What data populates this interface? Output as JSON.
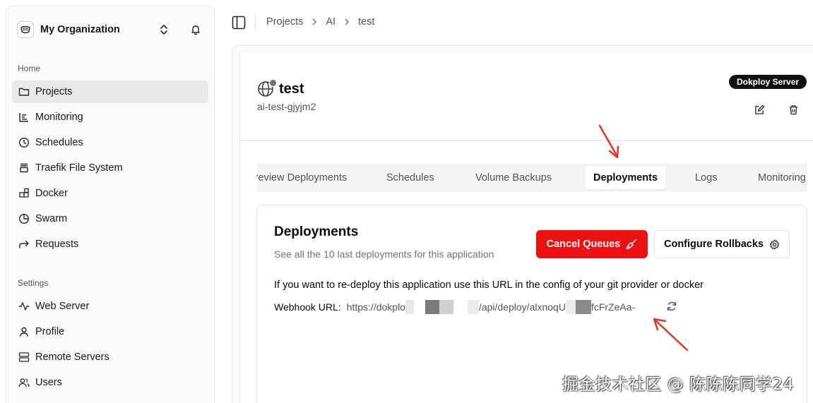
{
  "sidebar": {
    "org_name": "My Organization",
    "groups": [
      {
        "label": "Home"
      },
      {
        "label": "Settings"
      }
    ],
    "home_items": [
      {
        "label": "Projects",
        "icon": "folder-icon",
        "active": true
      },
      {
        "label": "Monitoring",
        "icon": "chart-icon"
      },
      {
        "label": "Schedules",
        "icon": "clock-icon"
      },
      {
        "label": "Traefik File System",
        "icon": "layers-icon"
      },
      {
        "label": "Docker",
        "icon": "blocks-icon"
      },
      {
        "label": "Swarm",
        "icon": "pie-icon"
      },
      {
        "label": "Requests",
        "icon": "forward-arrow-icon"
      }
    ],
    "settings_items": [
      {
        "label": "Web Server",
        "icon": "activity-icon"
      },
      {
        "label": "Profile",
        "icon": "user-icon"
      },
      {
        "label": "Remote Servers",
        "icon": "server-icon"
      },
      {
        "label": "Users",
        "icon": "users-icon"
      }
    ]
  },
  "breadcrumb": [
    "Projects",
    "AI",
    "test"
  ],
  "app": {
    "title": "test",
    "slug": "ai-test-gjyjm2",
    "server_badge": "Dokploy Server"
  },
  "tabs": [
    {
      "label": "Preview Deployments"
    },
    {
      "label": "Schedules"
    },
    {
      "label": "Volume Backups"
    },
    {
      "label": "Deployments",
      "active": true
    },
    {
      "label": "Logs"
    },
    {
      "label": "Monitoring"
    }
  ],
  "deployments": {
    "title": "Deployments",
    "subtitle": "See all the 10 last deployments for this application",
    "cancel_label": "Cancel Queues",
    "rollback_label": "Configure Rollbacks",
    "info": "If you want to re-deploy this application use this URL in the config of your git provider or docker",
    "webhook_label": "Webhook URL:",
    "webhook_url_start": "https://dokplo",
    "webhook_url_mid": "/api/deploy/alxnoqU",
    "webhook_url_end": "fcFrZeAa-"
  },
  "watermark": "掘金技术社区 @ 陈陈陈同学24",
  "colors": {
    "accent_red": "#ef1111",
    "annotation_arrow": "#e8341c",
    "active_nav_bg": "#e9e9eb"
  }
}
